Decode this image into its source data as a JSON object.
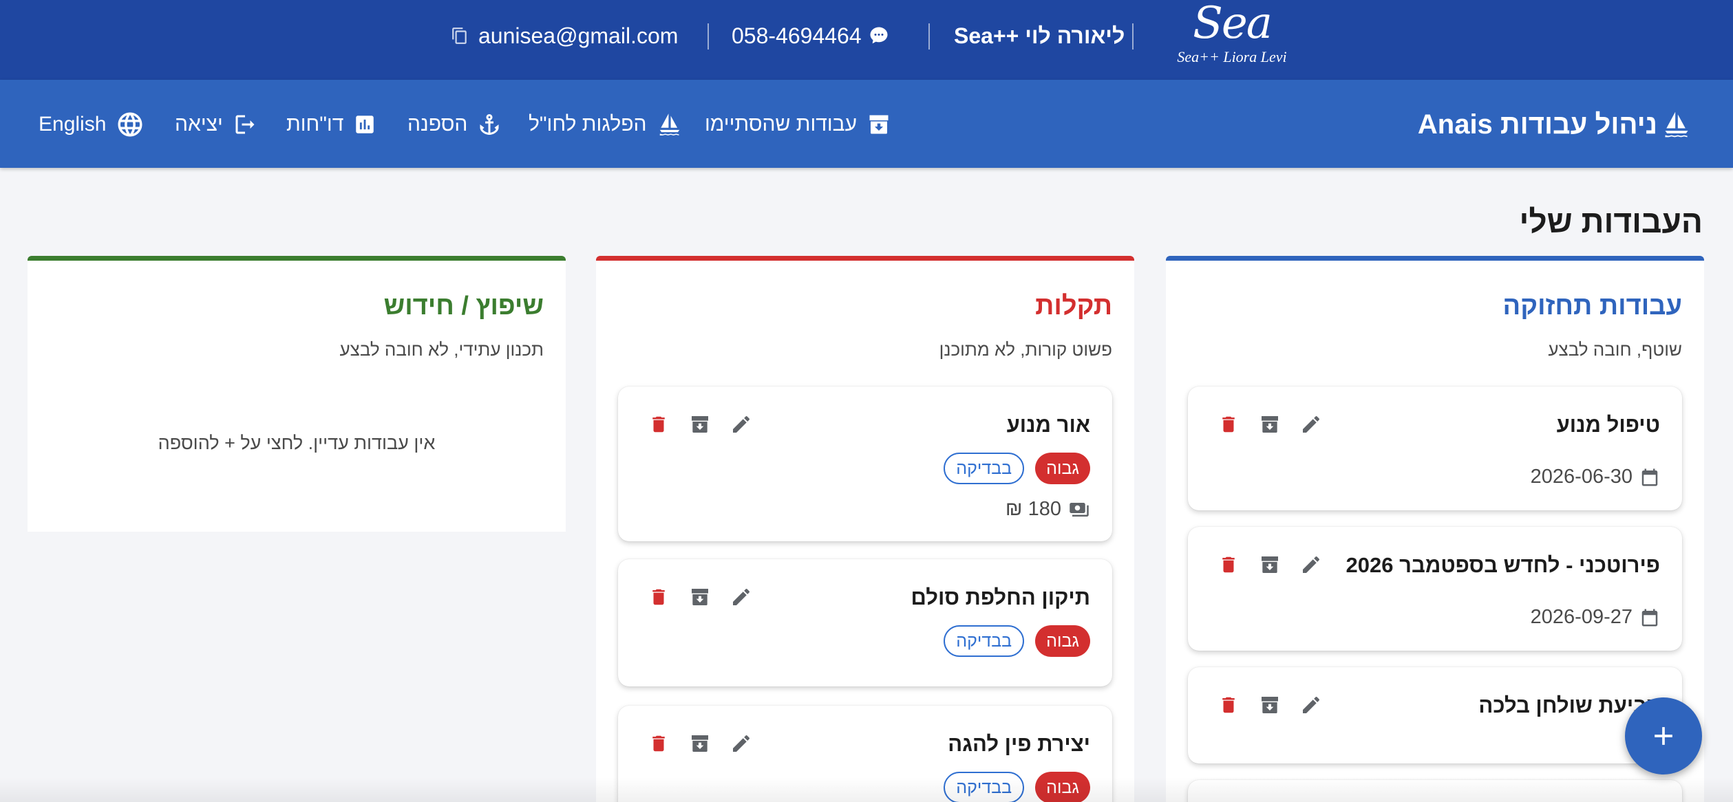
{
  "topbar": {
    "email": "aunisea@gmail.com",
    "phone": "058-4694464",
    "owner": "ליאורה לוי ++Sea",
    "logo_script": "Sea",
    "logo_sub": "Sea++ Liora Levi"
  },
  "navbar": {
    "brand": "ניהול עבודות Anais",
    "items": {
      "completed": "עבודות שהסתיימו",
      "voyages": "הפלגות לחו\"ל",
      "supply": "הספנה",
      "reports": "דו\"חות",
      "logout": "יציאה",
      "language": "English"
    }
  },
  "page": {
    "title": "העבודות שלי"
  },
  "columns": {
    "maintenance": {
      "title": "עבודות תחזוקה",
      "subtitle": "שוטף, חובה לבצע",
      "color": "#2f64bd",
      "cards": [
        {
          "title": "טיפול מנוע",
          "date": "2026-06-30"
        },
        {
          "title": "פירוטכני - לחדש בספטמבר 2026",
          "date": "2026-09-27"
        },
        {
          "title": "צביעת שולחן בלכה"
        }
      ]
    },
    "faults": {
      "title": "תקלות",
      "subtitle": "פשוט קורות, לא מתוכנן",
      "color": "#d32f2f",
      "cards": [
        {
          "title": "אור מנוע",
          "priority": "גבוה",
          "status": "בבדיקה",
          "cost": "180 ₪"
        },
        {
          "title": "תיקון החלפת סולם",
          "priority": "גבוה",
          "status": "בבדיקה"
        },
        {
          "title": "יצירת פין להגה",
          "priority": "גבוה",
          "status": "בבדיקה"
        }
      ]
    },
    "renovation": {
      "title": "שיפוץ / חידוש",
      "subtitle": "תכנון עתידי, לא חובה לבצע",
      "color": "#3b7d2f",
      "empty_text": "אין עבודות עדיין. לחצי על + להוספה"
    }
  },
  "icons": {
    "delete": "trash-icon",
    "archive": "archive-icon",
    "edit": "pencil-icon",
    "calendar": "calendar-icon",
    "cost": "money-icon",
    "add": "plus-icon"
  },
  "colors": {
    "topbar": "#1f47a1",
    "navbar": "#2f64bd",
    "delete": "#d32f2f",
    "neutral_icon": "#5f6368"
  }
}
